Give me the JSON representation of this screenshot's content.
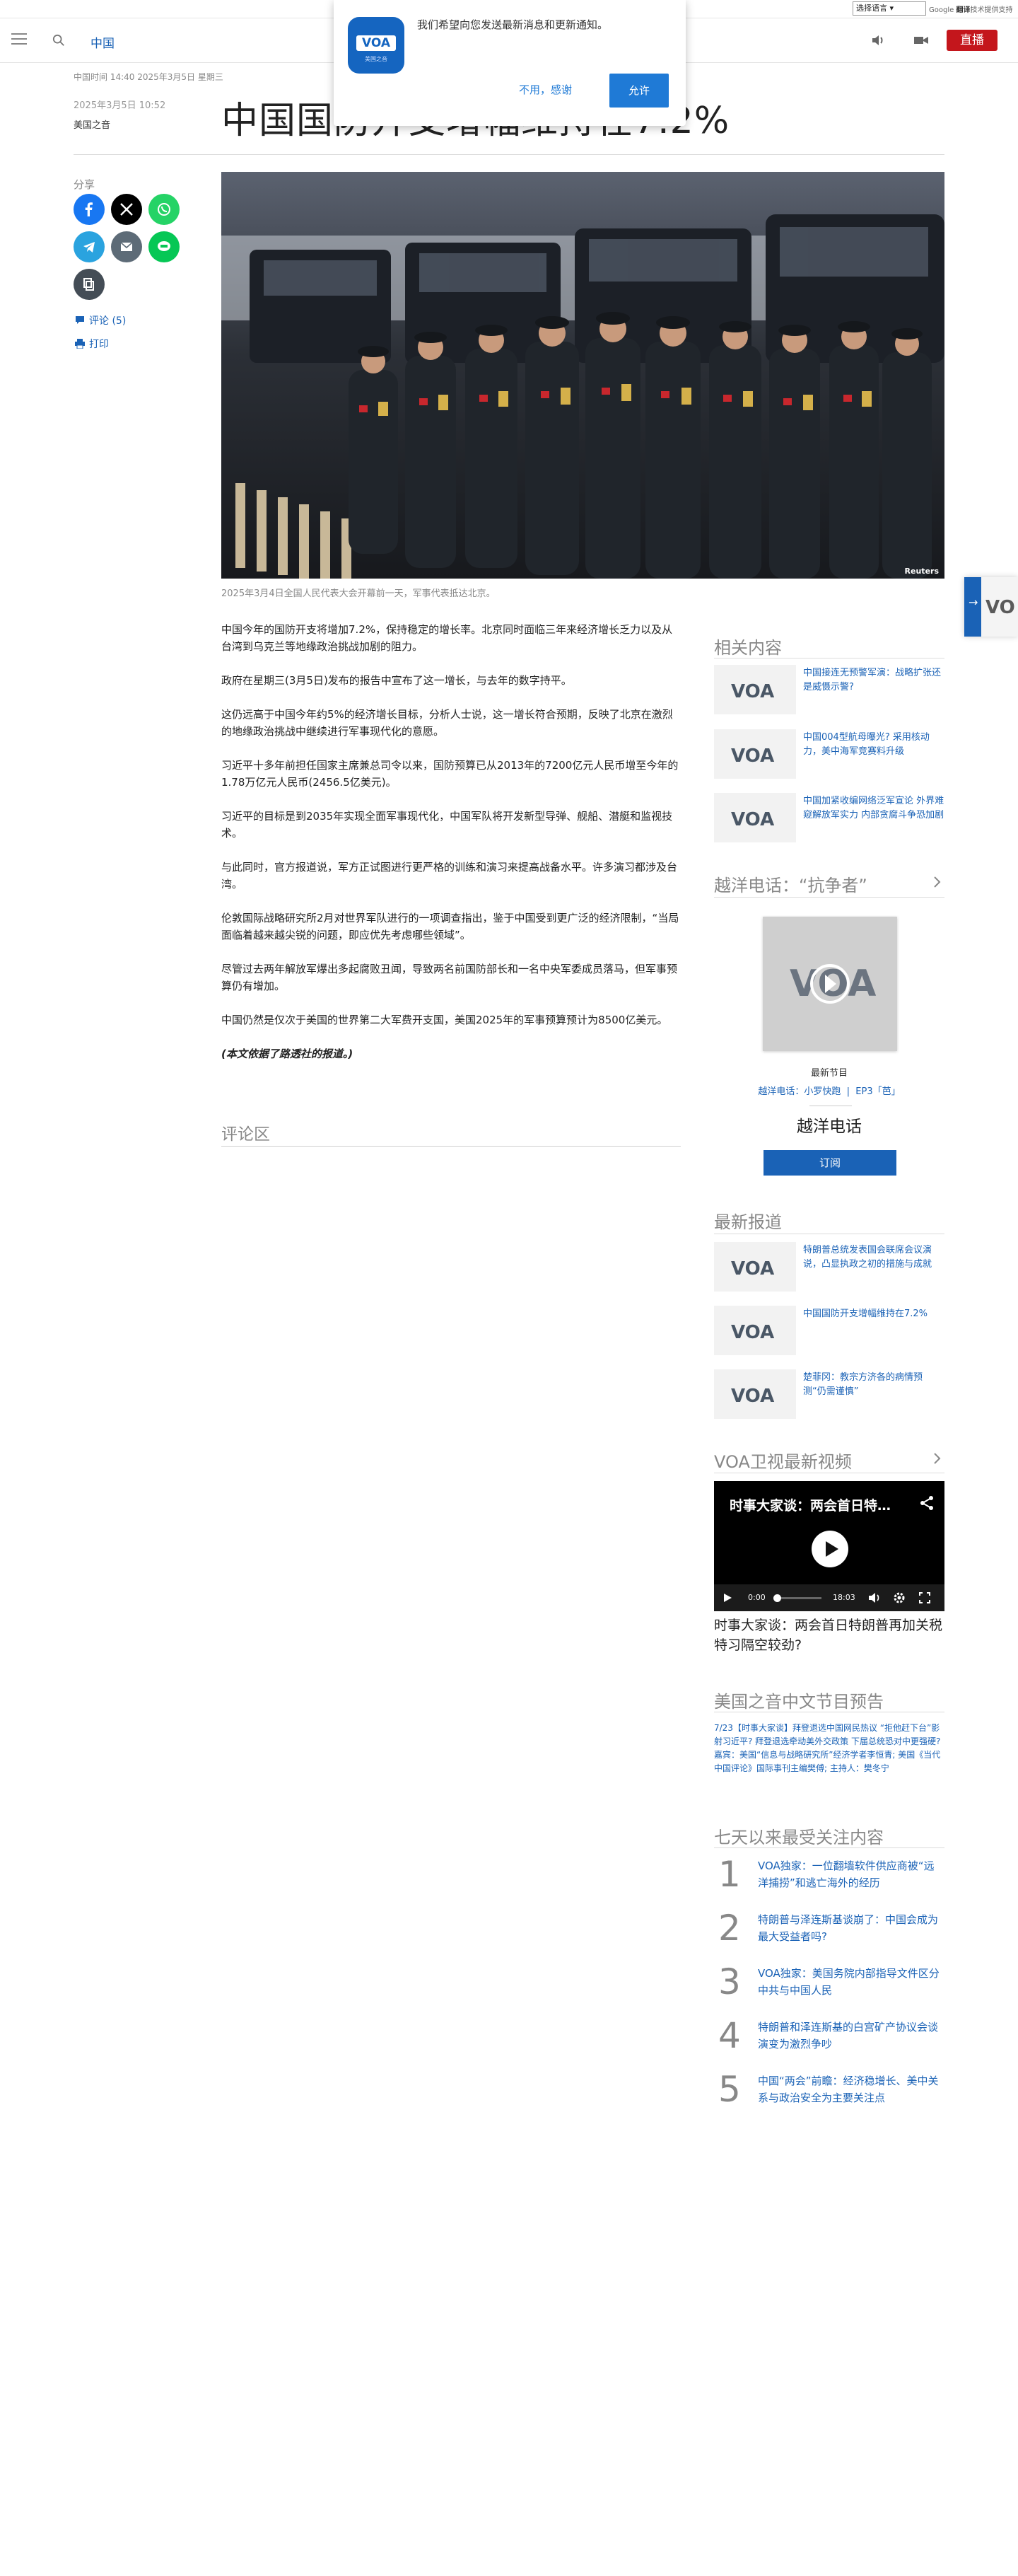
{
  "topbar": {
    "language_select": "选择语言",
    "translate_powered": "Google",
    "translate_label": "翻译",
    "translate_suffix": "技术提供支持"
  },
  "header": {
    "section": "中国",
    "live_label": "直播"
  },
  "notification": {
    "message": "我们希望向您发送最新消息和更新通知。",
    "logo_text": "VOA",
    "logo_sub": "美国之音",
    "decline": "不用，感谢",
    "accept": "允许"
  },
  "article": {
    "dateline": "中国时间 14:40 2025年3月5日 星期三",
    "pub_date": "2025年3月5日 10:52",
    "byline": "美国之音",
    "headline": "中国国防开支增幅维持在7.2%",
    "image_credit": "Reuters",
    "caption": "2025年3月4日全国人民代表大会开幕前一天，军事代表抵达北京。",
    "paragraphs": [
      "中国今年的国防开支将增加7.2%，保持稳定的增长率。北京同时面临三年来经济增长乏力以及从台湾到乌克兰等地缘政治挑战加剧的阻力。",
      "政府在星期三(3月5日)发布的报告中宣布了这一增长，与去年的数字持平。",
      "这仍远高于中国今年约5%的经济增长目标，分析人士说，这一增长符合预期，反映了北京在激烈的地缘政治挑战中继续进行军事现代化的意愿。",
      "习近平十多年前担任国家主席兼总司令以来，国防预算已从2013年的7200亿元人民币增至今年的1.78万亿元人民币(2456.5亿美元)。",
      "习近平的目标是到2035年实现全面军事现代化，中国军队将开发新型导弹、舰船、潜艇和监视技术。",
      "与此同时，官方报道说，军方正试图进行更严格的训练和演习来提高战备水平。许多演习都涉及台湾。",
      "伦敦国际战略研究所2月对世界军队进行的一项调查指出，鉴于中国受到更广泛的经济限制，“当局面临着越来越尖锐的问题，即应优先考虑哪些领域”。",
      "尽管过去两年解放军爆出多起腐败丑闻，导致两名前国防部长和一名中央军委成员落马，但军事预算仍有增加。",
      "中国仍然是仅次于美国的世界第二大军费开支国，美国2025年的军事预算预计为8500亿美元。"
    ],
    "note": "(本文依据了路透社的报道。)"
  },
  "share": {
    "label": "分享",
    "comments": "评论 (5)",
    "print": "打印"
  },
  "comments_section": {
    "title": "评论区"
  },
  "related": {
    "title": "相关内容",
    "items": [
      "中国接连无预警军演：战略扩张还是威慑示警?",
      "中国004型航母曝光? 采用核动力，美中海军竞赛料升级",
      "中国加紧收编网络泛军宣论 外界难窥解放军实力 内部贪腐斗争恐加剧"
    ]
  },
  "program": {
    "title": "越洋电话：“抗争者”",
    "newest": "最新节目",
    "episode_show": "越洋电话：小罗快跑",
    "episode_num": "EP3「芭」",
    "name": "越洋电话",
    "subscribe": "订阅"
  },
  "latest": {
    "title": "最新报道",
    "items": [
      "特朗普总统发表国会联席会议演说，凸显执政之初的措施与成就",
      "中国国防开支增幅维持在7.2%",
      "楚菲冈：教宗方济各的病情预测“仍需谨慎”"
    ]
  },
  "video": {
    "section_title": "VOA卫视最新视频",
    "overlay_title": "时事大家谈：两会首日特…",
    "time_current": "0:00",
    "time_total": "18:03",
    "progress": 0,
    "caption": "时事大家谈：两会首日特朗普再加关税 特习隔空较劲?"
  },
  "schedule": {
    "title": "美国之音中文节目预告",
    "text": "7/23【时事大家谈】拜登退选中国网民热议 “拒他赶下台”影射习近平? 拜登退选牵动美外交政策 下届总统恐对中更强硬? 嘉宾：美国“信息与战略研究所”经济学者李恒青; 美国《当代中国评论》国际事刊主编樊傅; 主持人：樊冬宁"
  },
  "popular": {
    "title": "七天以来最受关注内容",
    "items": [
      {
        "num": "1",
        "text": "VOA独家：一位翻墙软件供应商被“远洋捕捞”和逃亡海外的经历"
      },
      {
        "num": "2",
        "text": "特朗普与泽连斯基谈崩了：中国会成为最大受益者吗?"
      },
      {
        "num": "3",
        "text": "VOA独家：美国务院内部指导文件区分中共与中国人民"
      },
      {
        "num": "4",
        "text": "特朗普和泽连斯基的白宫矿产协议会谈演变为激烈争吵"
      },
      {
        "num": "5",
        "text": "中国“两会”前瞻：经济稳增长、美中关系与政治安全为主要关注点"
      }
    ]
  },
  "colors": {
    "link_blue": "#1a62b6",
    "live_red": "#c4161c",
    "notify_blue": "#1f7ad6"
  }
}
